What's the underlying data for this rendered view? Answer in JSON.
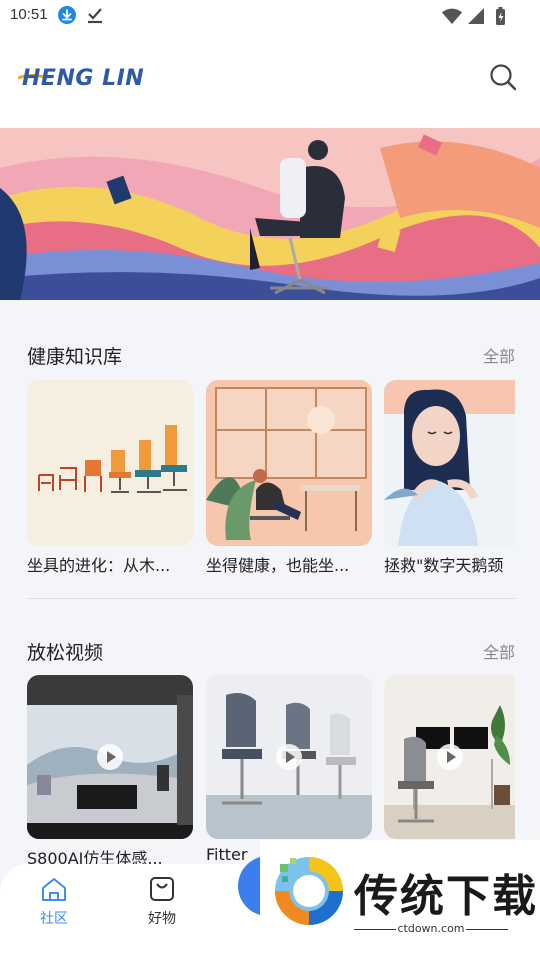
{
  "status_bar": {
    "time": "10:51"
  },
  "header": {
    "logo_text": "HENG LIN",
    "logo_icon": "logo-swoosh",
    "search_icon": "search-icon"
  },
  "knowledge": {
    "title": "健康知识库",
    "all_label": "全部",
    "cards": [
      {
        "caption": "坐具的进化：从木..."
      },
      {
        "caption": "坐得健康，也能坐..."
      },
      {
        "caption": "拯救\"数字天鹅颈"
      }
    ]
  },
  "videos": {
    "title": "放松视频",
    "all_label": "全部",
    "cards": [
      {
        "caption": "S800AI仿生体感..."
      },
      {
        "caption": "Fitter"
      },
      {
        "caption": ""
      }
    ]
  },
  "tabbar": {
    "items": [
      {
        "label": "社区",
        "icon": "home-icon",
        "active": true
      },
      {
        "label": "好物",
        "icon": "bag-icon",
        "active": false
      }
    ]
  },
  "watermark": {
    "title": "传统下载",
    "url": "ctdown.com"
  },
  "colors": {
    "accent": "#3c8ff0",
    "logo": "#2e5aa6",
    "logo_accent": "#f2a623",
    "background": "#f4f5f9"
  }
}
